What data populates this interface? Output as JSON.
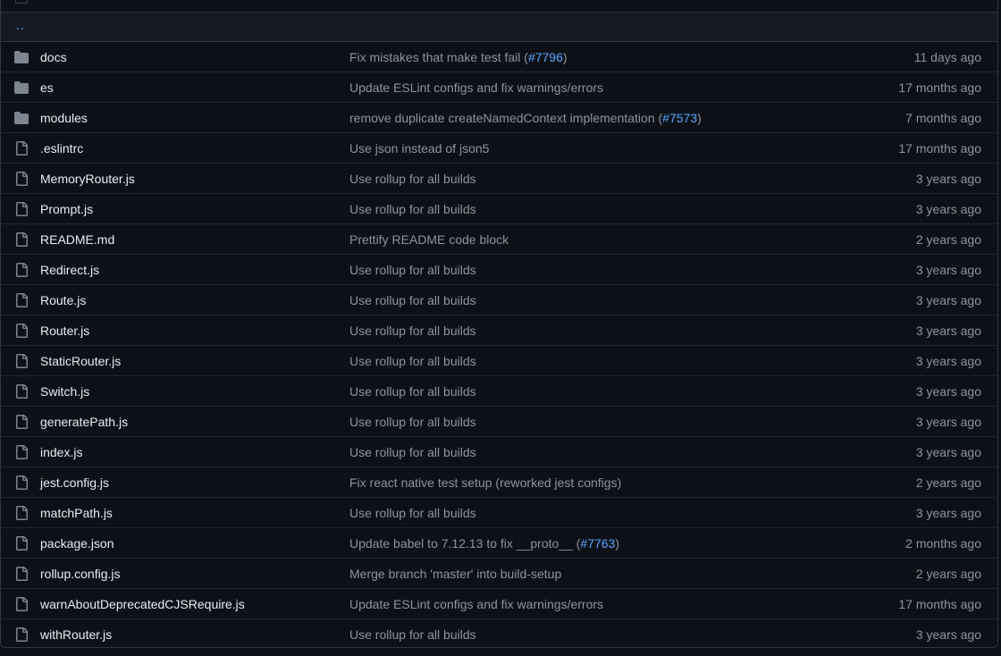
{
  "listing": {
    "parent_link": "..",
    "rows": [
      {
        "type": "dir",
        "name": "docs",
        "msg_pre": "Fix mistakes that make test fail (",
        "pr": "#7796",
        "msg_post": ")",
        "age": "11 days ago"
      },
      {
        "type": "dir",
        "name": "es",
        "msg_pre": "Update ESLint configs and fix warnings/errors",
        "pr": "",
        "msg_post": "",
        "age": "17 months ago"
      },
      {
        "type": "dir",
        "name": "modules",
        "msg_pre": "remove duplicate createNamedContext implementation (",
        "pr": "#7573",
        "msg_post": ")",
        "age": "7 months ago"
      },
      {
        "type": "file",
        "name": ".eslintrc",
        "msg_pre": "Use json instead of json5",
        "pr": "",
        "msg_post": "",
        "age": "17 months ago"
      },
      {
        "type": "file",
        "name": "MemoryRouter.js",
        "msg_pre": "Use rollup for all builds",
        "pr": "",
        "msg_post": "",
        "age": "3 years ago"
      },
      {
        "type": "file",
        "name": "Prompt.js",
        "msg_pre": "Use rollup for all builds",
        "pr": "",
        "msg_post": "",
        "age": "3 years ago"
      },
      {
        "type": "file",
        "name": "README.md",
        "msg_pre": "Prettify README code block",
        "pr": "",
        "msg_post": "",
        "age": "2 years ago"
      },
      {
        "type": "file",
        "name": "Redirect.js",
        "msg_pre": "Use rollup for all builds",
        "pr": "",
        "msg_post": "",
        "age": "3 years ago"
      },
      {
        "type": "file",
        "name": "Route.js",
        "msg_pre": "Use rollup for all builds",
        "pr": "",
        "msg_post": "",
        "age": "3 years ago"
      },
      {
        "type": "file",
        "name": "Router.js",
        "msg_pre": "Use rollup for all builds",
        "pr": "",
        "msg_post": "",
        "age": "3 years ago"
      },
      {
        "type": "file",
        "name": "StaticRouter.js",
        "msg_pre": "Use rollup for all builds",
        "pr": "",
        "msg_post": "",
        "age": "3 years ago"
      },
      {
        "type": "file",
        "name": "Switch.js",
        "msg_pre": "Use rollup for all builds",
        "pr": "",
        "msg_post": "",
        "age": "3 years ago"
      },
      {
        "type": "file",
        "name": "generatePath.js",
        "msg_pre": "Use rollup for all builds",
        "pr": "",
        "msg_post": "",
        "age": "3 years ago"
      },
      {
        "type": "file",
        "name": "index.js",
        "msg_pre": "Use rollup for all builds",
        "pr": "",
        "msg_post": "",
        "age": "3 years ago"
      },
      {
        "type": "file",
        "name": "jest.config.js",
        "msg_pre": "Fix react native test setup (reworked jest configs)",
        "pr": "",
        "msg_post": "",
        "age": "2 years ago"
      },
      {
        "type": "file",
        "name": "matchPath.js",
        "msg_pre": "Use rollup for all builds",
        "pr": "",
        "msg_post": "",
        "age": "3 years ago"
      },
      {
        "type": "file",
        "name": "package.json",
        "msg_pre": "Update babel to 7.12.13 to fix __proto__ (",
        "pr": "#7763",
        "msg_post": ")",
        "age": "2 months ago"
      },
      {
        "type": "file",
        "name": "rollup.config.js",
        "msg_pre": "Merge branch 'master' into build-setup",
        "pr": "",
        "msg_post": "",
        "age": "2 years ago"
      },
      {
        "type": "file",
        "name": "warnAboutDeprecatedCJSRequire.js",
        "msg_pre": "Update ESLint configs and fix warnings/errors",
        "pr": "",
        "msg_post": "",
        "age": "17 months ago"
      },
      {
        "type": "file",
        "name": "withRouter.js",
        "msg_pre": "Use rollup for all builds",
        "pr": "",
        "msg_post": "",
        "age": "3 years ago"
      }
    ]
  },
  "colors": {
    "background": "#0d1117",
    "header_row": "#161b22",
    "border": "#30363d",
    "text": "#e6edf3",
    "muted": "#8b949e",
    "link": "#58a6ff",
    "icon": "#7d8590"
  },
  "icons": {
    "dir": "folder-icon",
    "file": "file-icon"
  }
}
